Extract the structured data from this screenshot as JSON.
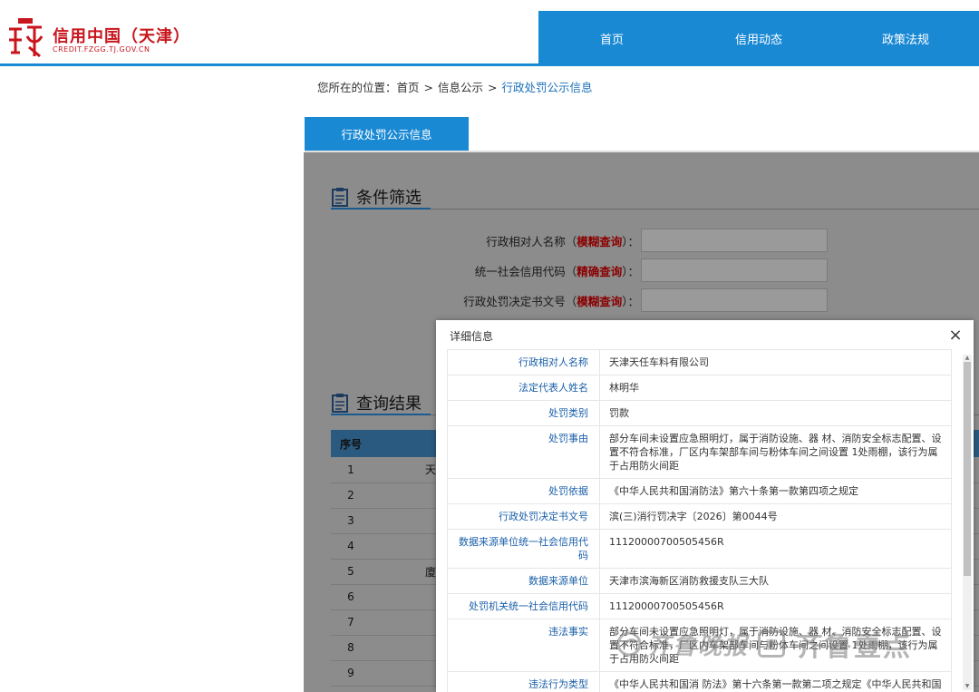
{
  "site": {
    "title": "信用中国（天津）",
    "subtitle": "CREDIT.FZGG.TJ.GOV.CN",
    "nav": [
      "首页",
      "信用动态",
      "政策法规"
    ],
    "brand_color": "#1a89d4",
    "logo_color": "#c8161d"
  },
  "breadcrumb": {
    "prefix": "您所在的位置：",
    "items": [
      "首页",
      "信息公示"
    ],
    "current": "行政处罚公示信息"
  },
  "tab": {
    "label": "行政处罚公示信息"
  },
  "filter": {
    "heading": "条件筛选",
    "fields": [
      {
        "label": "行政相对人名称（",
        "mode": "模糊查询",
        "suffix": "）：",
        "value": ""
      },
      {
        "label": "统一社会信用代码（",
        "mode": "精确查询",
        "suffix": "）：",
        "value": ""
      },
      {
        "label": "行政处罚决定书文号（",
        "mode": "模糊查询",
        "suffix": "）：",
        "value": ""
      }
    ]
  },
  "results": {
    "heading": "查询结果",
    "columns": [
      "序号",
      ""
    ],
    "rows": [
      {
        "no": "1",
        "name": "天"
      },
      {
        "no": "2",
        "name": ""
      },
      {
        "no": "3",
        "name": ""
      },
      {
        "no": "4",
        "name": ""
      },
      {
        "no": "5",
        "name": "廈"
      },
      {
        "no": "6",
        "name": ""
      },
      {
        "no": "7",
        "name": ""
      },
      {
        "no": "8",
        "name": ""
      },
      {
        "no": "9",
        "name": ""
      }
    ]
  },
  "modal": {
    "title": "详细信息",
    "close": "×",
    "rows": [
      {
        "key": "行政相对人名称",
        "value": "天津天任车料有限公司"
      },
      {
        "key": "法定代表人姓名",
        "value": "林明华"
      },
      {
        "key": "处罚类别",
        "value": "罚款"
      },
      {
        "key": "处罚事由",
        "value": "部分车间未设置应急照明灯，属于消防设施、器 材、消防安全标志配置、设置不符合标准，厂区内车架部车间与粉体车间之间设置 1处雨棚，该行为属于占用防火间距"
      },
      {
        "key": "处罚依据",
        "value": "《中华人民共和国消防法》第六十条第一款第四项之规定"
      },
      {
        "key": "行政处罚决定书文号",
        "value": "滨(三)消行罚决字〔2026〕第0044号"
      },
      {
        "key": "数据来源单位统一社会信用代码",
        "value": "11120000700505456R"
      },
      {
        "key": "数据来源单位",
        "value": "天津市滨海新区消防救援支队三大队"
      },
      {
        "key": "处罚机关统一社会信用代码",
        "value": "11120000700505456R"
      },
      {
        "key": "违法事实",
        "value": "部分车间未设置应急照明灯，属于消防设施、器 材、消防安全标志配置、设置不符合标准，厂区内车架部车间与粉体车间之间设置 1处雨棚，该行为属于占用防火间距"
      },
      {
        "key": "违法行为类型",
        "value": "《中华人民共和国消 防法》第十六条第一款第二项之规定《中华人民共和国消防法》第二十八条之规定"
      }
    ]
  },
  "watermark": {
    "text1": "齐鲁晚报",
    "badge": "壹",
    "text2": "齐鲁壹点"
  }
}
